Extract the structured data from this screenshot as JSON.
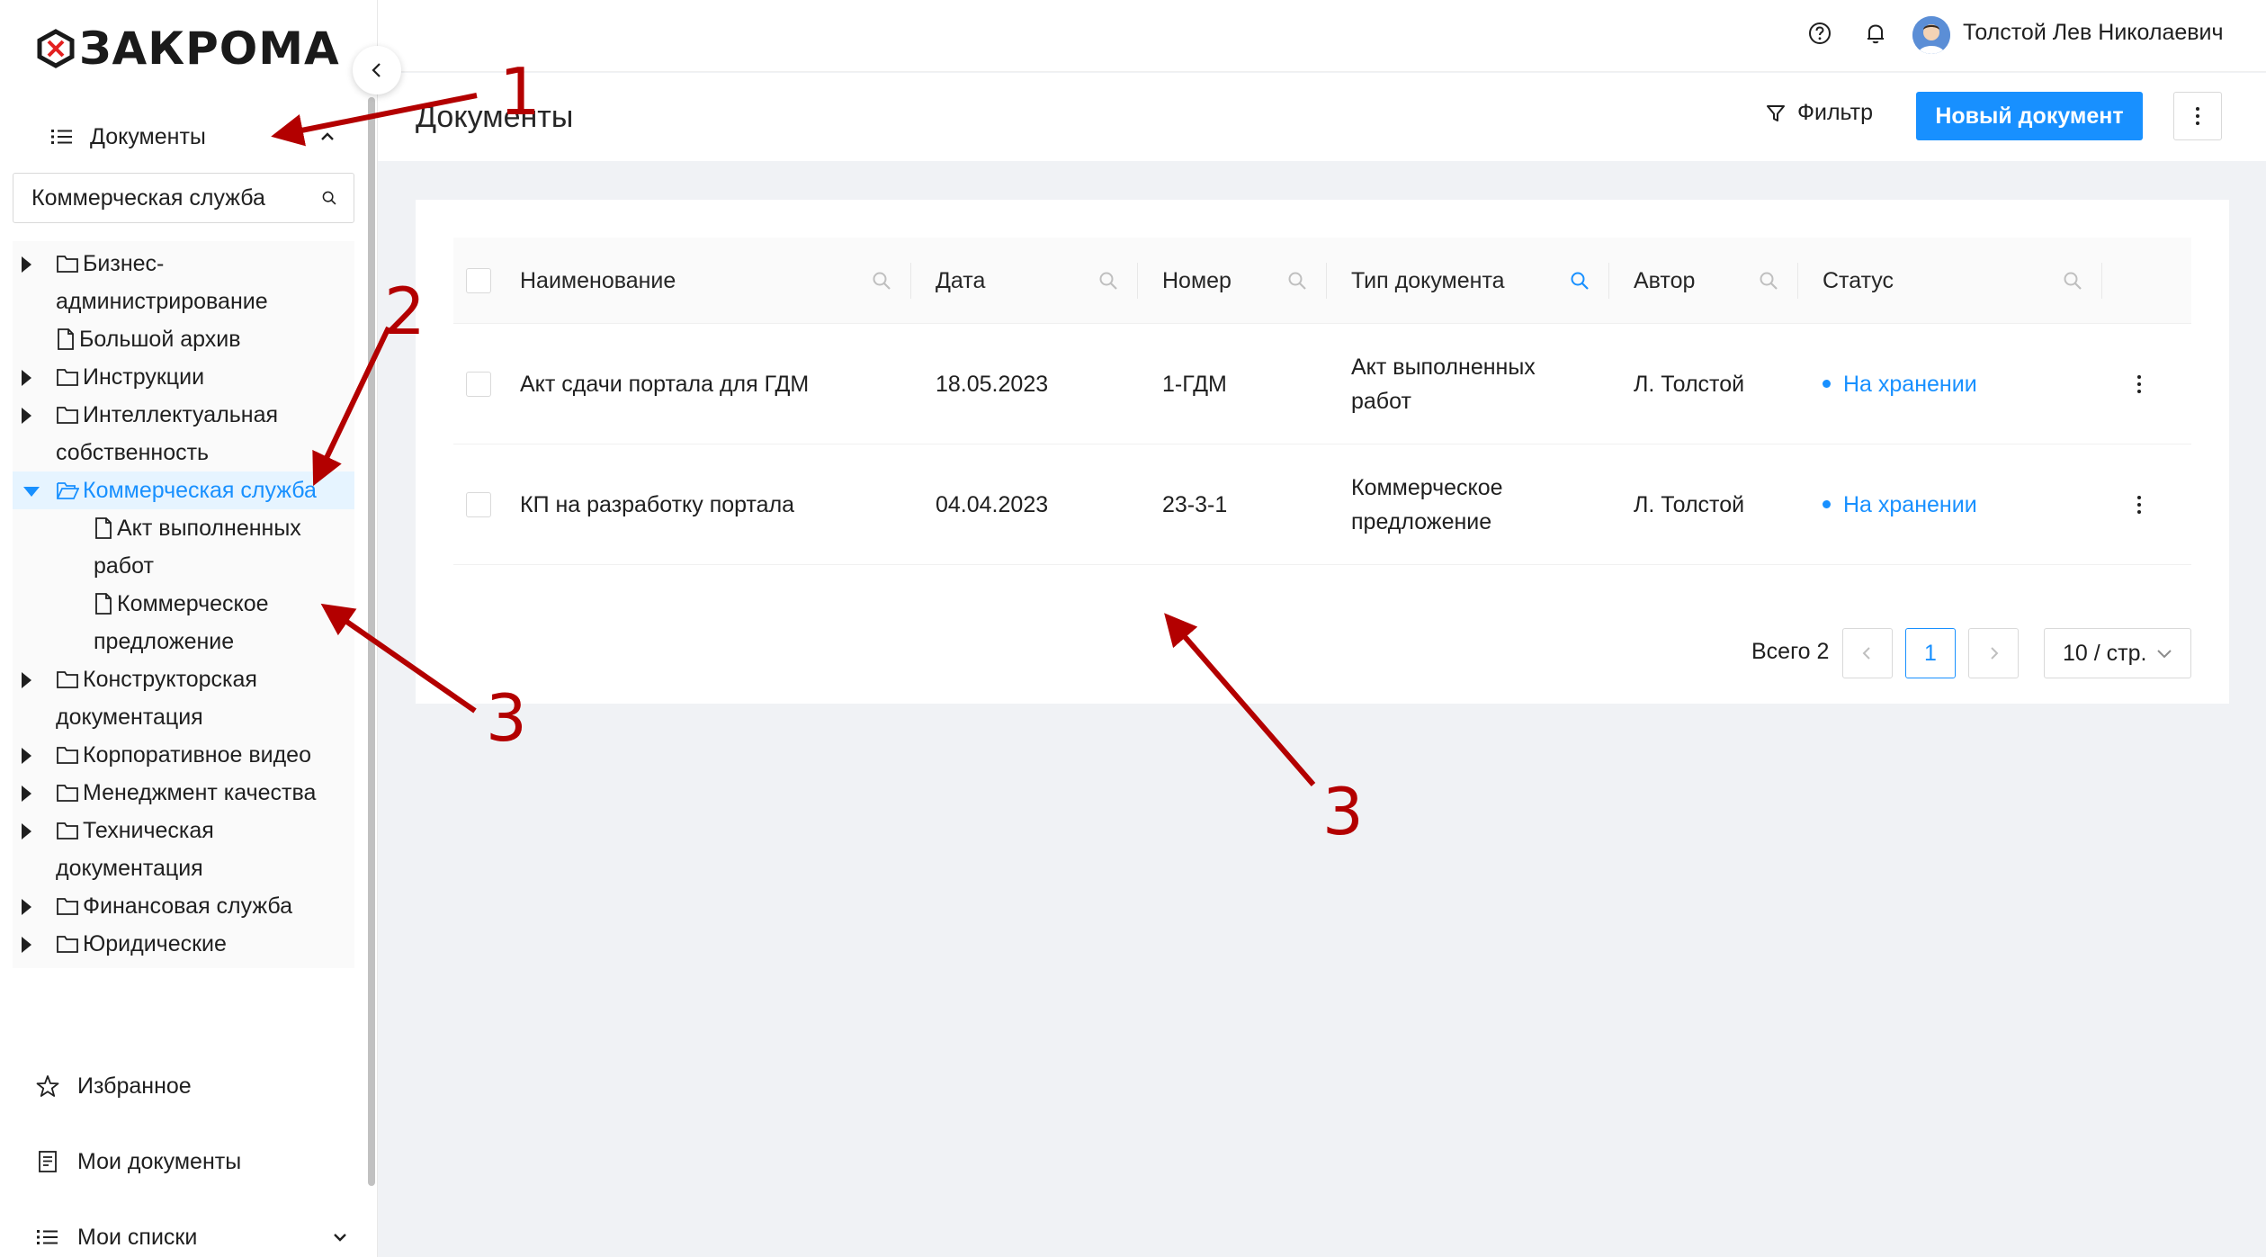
{
  "app": {
    "logo_text": "ЗАКРОМА"
  },
  "sidebar": {
    "section_label": "Документы",
    "search_value": "Коммерческая служба",
    "tree": [
      {
        "label": "Бизнес-администрирование",
        "type": "folder"
      },
      {
        "label": "Большой архив",
        "type": "file"
      },
      {
        "label": "Инструкции",
        "type": "folder"
      },
      {
        "label": "Интеллектуальная собственность",
        "type": "folder"
      },
      {
        "label": "Коммерческая служба",
        "type": "folder-open"
      },
      {
        "label": "Акт выполненных работ",
        "type": "file"
      },
      {
        "label": "Коммерческое предложение",
        "type": "file"
      },
      {
        "label": "Конструкторская документация",
        "type": "folder"
      },
      {
        "label": "Корпоративное видео",
        "type": "folder"
      },
      {
        "label": "Менеджмент качества",
        "type": "folder"
      },
      {
        "label": "Техническая документация",
        "type": "folder"
      },
      {
        "label": "Финансовая служба",
        "type": "folder"
      },
      {
        "label": "Юридические",
        "type": "folder"
      }
    ],
    "favorites_label": "Избранное",
    "my_docs_label": "Мои документы",
    "my_lists_label": "Мои списки"
  },
  "topbar": {
    "user_name": "Толстой Лев Николаевич",
    "help_icon": "question-circle-icon",
    "bell_icon": "bell-icon"
  },
  "page": {
    "title": "Документы",
    "filter_label": "Фильтр",
    "new_doc_label": "Новый документ"
  },
  "table": {
    "columns": [
      "Наименование",
      "Дата",
      "Номер",
      "Тип документа",
      "Автор",
      "Статус"
    ],
    "rows": [
      {
        "name": "Акт сдачи портала для ГДМ",
        "date": "18.05.2023",
        "number": "1-ГДМ",
        "type": "Акт выполненных работ",
        "author": "Л. Толстой",
        "status": "На хранении"
      },
      {
        "name": "КП на разработку портала",
        "date": "04.04.2023",
        "number": "23-3-1",
        "type": "Коммерческое предложение",
        "author": "Л. Толстой",
        "status": "На хранении"
      }
    ]
  },
  "pagination": {
    "total_label": "Всего 2",
    "current_page": "1",
    "page_size_label": "10 / стр."
  },
  "annotations": {
    "marker_1": "1",
    "marker_2": "2",
    "marker_3a": "3",
    "marker_3b": "3",
    "color": "#b30000"
  }
}
